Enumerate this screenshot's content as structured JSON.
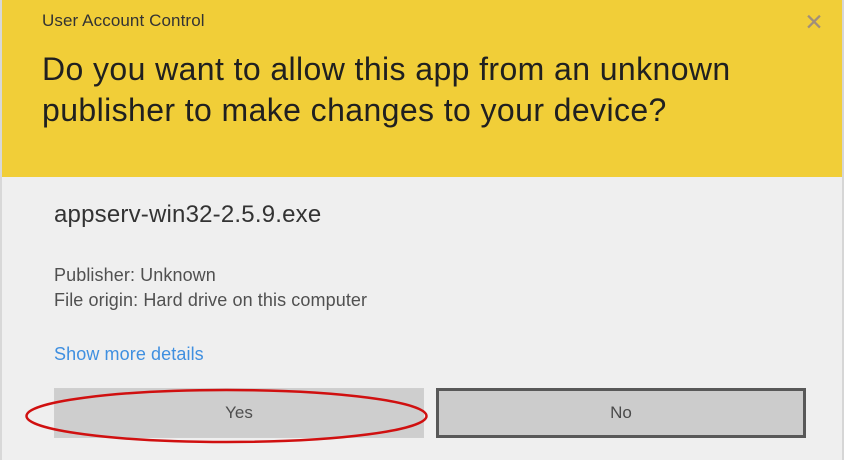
{
  "dialog": {
    "title": "User Account Control",
    "question": "Do you want to allow this app from an unknown publisher to make changes to your device?",
    "close_icon": "close-icon",
    "program_name": "appserv-win32-2.5.9.exe",
    "publisher": "Publisher: Unknown",
    "file_origin": "File origin: Hard drive on this computer",
    "details_link": "Show more details",
    "buttons": {
      "yes": "Yes",
      "no": "No"
    }
  },
  "colors": {
    "header_background": "#f1ce38",
    "link": "#3f8fe0",
    "highlight_annotation": "#d01010"
  }
}
